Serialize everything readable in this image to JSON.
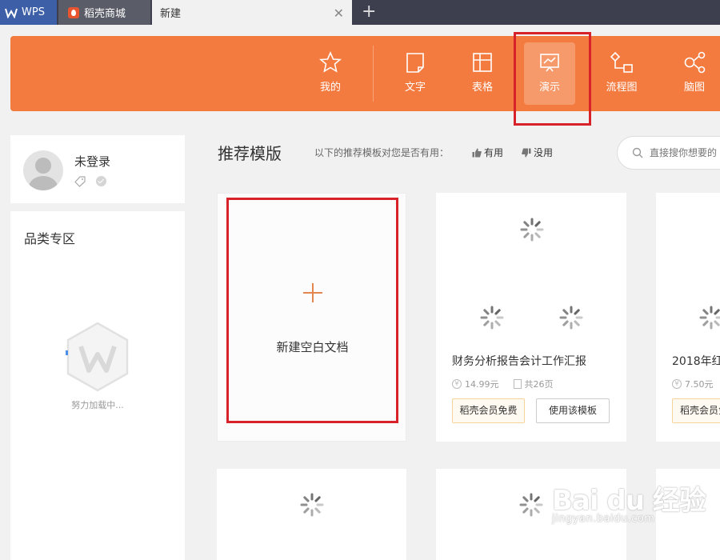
{
  "tabs": {
    "wps_label": "WPS",
    "shop_label": "稻壳商城",
    "new_label": "新建",
    "close_glyph": "✕",
    "add_glyph": "+"
  },
  "header": {
    "accent": "#f47b40",
    "items": [
      {
        "label": "我的",
        "icon": "star-icon"
      },
      {
        "label": "文字",
        "icon": "doc-icon"
      },
      {
        "label": "表格",
        "icon": "table-icon"
      },
      {
        "label": "演示",
        "icon": "presentation-icon",
        "active": true
      },
      {
        "label": "流程图",
        "icon": "flowchart-icon"
      },
      {
        "label": "脑图",
        "icon": "mindmap-icon"
      }
    ]
  },
  "user": {
    "status": "未登录"
  },
  "category": {
    "title": "品类专区",
    "loading_text": "努力加载中..."
  },
  "main": {
    "section_title": "推荐模版",
    "feedback_question": "以下的推荐模板对您是否有用：",
    "useful_label": "有用",
    "useless_label": "没用",
    "search_placeholder": "直接搜你想要的"
  },
  "templates": {
    "blank_label": "新建空白文档",
    "blank_plus": "+",
    "card2": {
      "title": "财务分析报告会计工作汇报",
      "price": "14.99元",
      "pages": "共26页",
      "member_btn": "稻壳会员免费",
      "use_btn": "使用该模板"
    },
    "card3": {
      "title": "2018年红",
      "price": "7.50元",
      "member_btn": "稻壳会员免"
    }
  },
  "watermark": {
    "main": "Bai du 经验",
    "sub": "jingyan.baidu.com"
  }
}
